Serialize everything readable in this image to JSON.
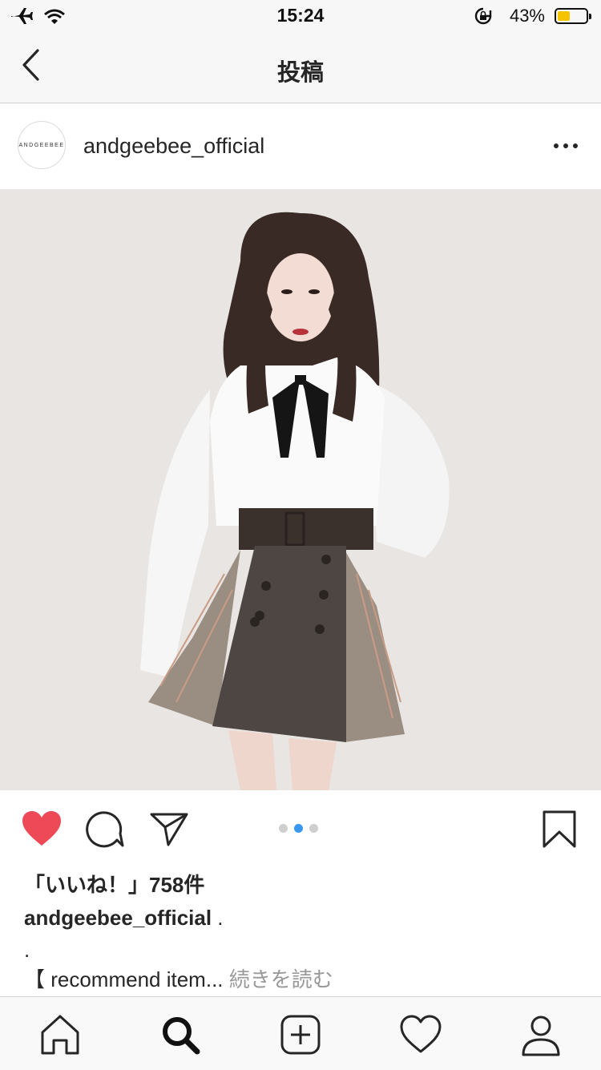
{
  "status_bar": {
    "time": "15:24",
    "battery_percent": "43%",
    "battery_level": 0.43
  },
  "nav": {
    "title": "投稿"
  },
  "post": {
    "avatar_text": "ANDGEEBEE",
    "username": "andgeebee_official",
    "likes": "「いいね！」758件",
    "caption_user": "andgeebee_official",
    "caption_text": " .",
    "caption_dot": ".",
    "caption_preview": "【 recommend item... ",
    "read_more": "続きを読む",
    "liked": true,
    "carousel": {
      "count": 3,
      "active_index": 1
    }
  },
  "colors": {
    "like_red": "#ed4956",
    "dot_active": "#3897f0",
    "battery_fill": "#f5c400"
  },
  "tab_bar": {
    "items": [
      {
        "name": "home-icon"
      },
      {
        "name": "search-icon"
      },
      {
        "name": "add-post-icon"
      },
      {
        "name": "activity-heart-icon"
      },
      {
        "name": "profile-icon"
      }
    ]
  }
}
